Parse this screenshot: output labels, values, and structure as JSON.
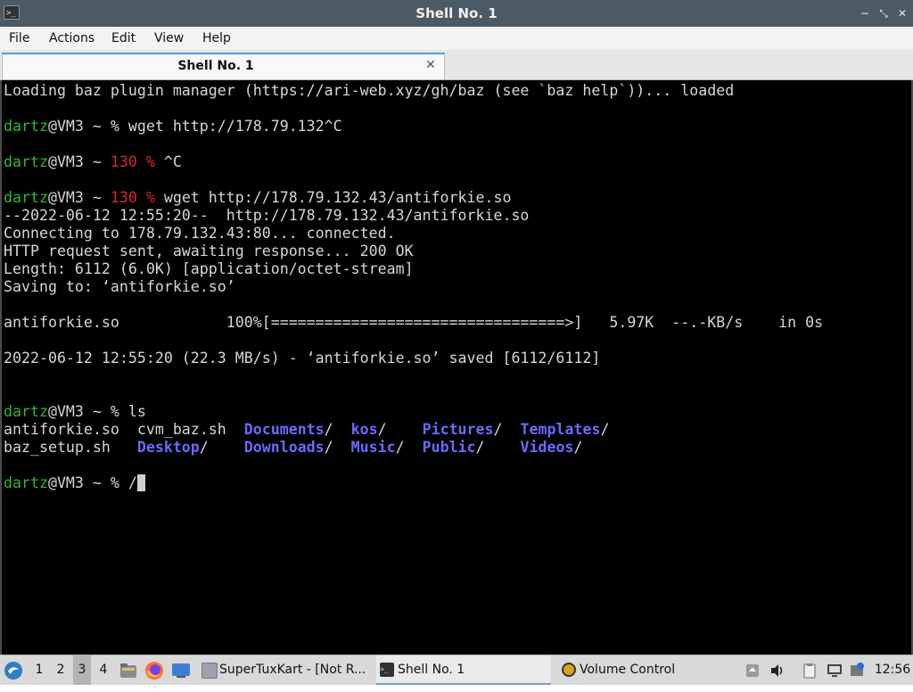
{
  "window": {
    "title": "Shell No. 1",
    "icon": "terminal-icon",
    "controls": {
      "minimize": "−",
      "maximize": "⤡",
      "close": "✕"
    }
  },
  "menubar": {
    "items": [
      "File",
      "Actions",
      "Edit",
      "View",
      "Help"
    ]
  },
  "tabs": [
    {
      "label": "Shell No. 1",
      "close": "✕"
    }
  ],
  "terminal": {
    "lines": [
      {
        "segments": [
          {
            "t": "Loading baz plugin manager (https://ari-web.xyz/gh/baz (see `baz help`))... loaded"
          }
        ]
      },
      {
        "segments": [
          {
            "t": "dartz",
            "c": "user"
          },
          {
            "t": "@VM3 ~ % wget http://178.79.132^C"
          }
        ]
      },
      {
        "segments": [
          {
            "t": "dartz",
            "c": "user"
          },
          {
            "t": "@VM3 ~ "
          },
          {
            "t": "130 %",
            "c": "err"
          },
          {
            "t": " ^C"
          }
        ]
      },
      {
        "segments": [
          {
            "t": "dartz",
            "c": "user"
          },
          {
            "t": "@VM3 ~ "
          },
          {
            "t": "130 %",
            "c": "err"
          },
          {
            "t": " wget http://178.79.132.43/antiforkie.so"
          }
        ]
      },
      {
        "segments": [
          {
            "t": "--2022-06-12 12:55:20--  http://178.79.132.43/antiforkie.so"
          }
        ]
      },
      {
        "segments": [
          {
            "t": "Connecting to 178.79.132.43:80... connected."
          }
        ]
      },
      {
        "segments": [
          {
            "t": "HTTP request sent, awaiting response... 200 OK"
          }
        ]
      },
      {
        "segments": [
          {
            "t": "Length: 6112 (6.0K) [application/octet-stream]"
          }
        ]
      },
      {
        "segments": [
          {
            "t": "Saving to: ‘antiforkie.so’"
          }
        ]
      },
      {
        "segments": [
          {
            "t": "antiforkie.so            100%[=================================>]   5.97K  --.-KB/s    in 0s"
          }
        ]
      },
      {
        "segments": [
          {
            "t": "2022-06-12 12:55:20 (22.3 MB/s) - ‘antiforkie.so’ saved [6112/6112]"
          }
        ]
      },
      {
        "segments": [
          {
            "t": "dartz",
            "c": "user"
          },
          {
            "t": "@VM3 ~ % ls"
          }
        ]
      },
      {
        "segments": [
          {
            "t": "antiforkie.so  cvm_baz.sh  "
          },
          {
            "t": "Documents",
            "c": "dir"
          },
          {
            "t": "/  "
          },
          {
            "t": "kos",
            "c": "dir"
          },
          {
            "t": "/    "
          },
          {
            "t": "Pictures",
            "c": "dir"
          },
          {
            "t": "/  "
          },
          {
            "t": "Templates",
            "c": "dir"
          },
          {
            "t": "/"
          }
        ]
      },
      {
        "segments": [
          {
            "t": "baz_setup.sh   "
          },
          {
            "t": "Desktop",
            "c": "dir"
          },
          {
            "t": "/    "
          },
          {
            "t": "Downloads",
            "c": "dir"
          },
          {
            "t": "/  "
          },
          {
            "t": "Music",
            "c": "dir"
          },
          {
            "t": "/  "
          },
          {
            "t": "Public",
            "c": "dir"
          },
          {
            "t": "/    "
          },
          {
            "t": "Videos",
            "c": "dir"
          },
          {
            "t": "/"
          }
        ]
      },
      {
        "segments": [
          {
            "t": "dartz",
            "c": "user"
          },
          {
            "t": "@VM3 ~ % /"
          }
        ],
        "cursor": true
      }
    ]
  },
  "taskbar": {
    "start_icon": "start-menu-icon",
    "workspaces": [
      {
        "label": "1",
        "active": false
      },
      {
        "label": "2",
        "active": false
      },
      {
        "label": "3",
        "active": true
      },
      {
        "label": "4",
        "active": false
      }
    ],
    "launchers": [
      "file-manager-icon",
      "firefox-icon",
      "desktop-icon"
    ],
    "tasks": [
      {
        "label": "SuperTuxKart - [Not R...",
        "icon": "window-icon",
        "active": false
      },
      {
        "label": "Shell No. 1",
        "icon": "terminal-icon",
        "active": true
      },
      {
        "label": "Volume Control",
        "icon": "volume-control-icon",
        "active": false
      }
    ],
    "tray": [
      "upload-icon",
      "speaker-icon",
      "clipboard-icon",
      "network-icon",
      "update-icon"
    ],
    "clock": "12:56"
  },
  "colors": {
    "titlebar": "#4c5a66",
    "terminal_bg": "#000000",
    "terminal_fg": "#d6d6d6",
    "user": "#2fb82f",
    "error_code": "#d42a2a",
    "directory": "#6a6aff",
    "tab_accent": "#4aa3df"
  }
}
